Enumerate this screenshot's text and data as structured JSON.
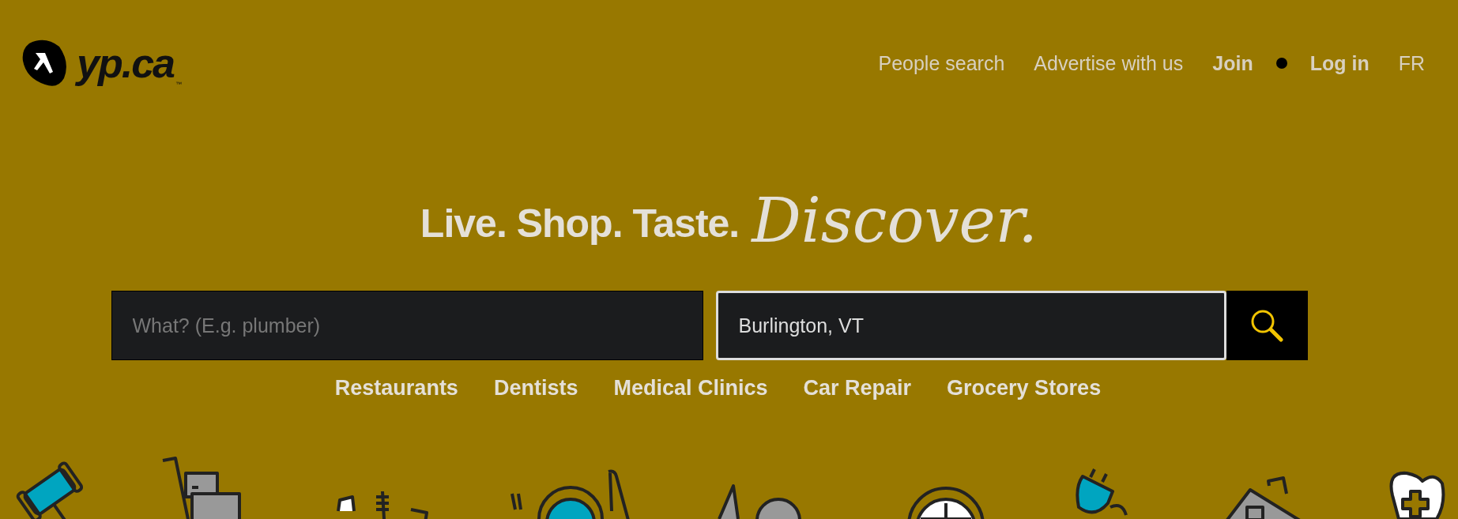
{
  "header": {
    "logo": "yp.ca",
    "logo_mark": "™",
    "nav": [
      {
        "label": "People search",
        "kind": "link"
      },
      {
        "label": "Advertise with us",
        "kind": "link"
      },
      {
        "label": "Join",
        "kind": "strong"
      },
      {
        "label": "Log in",
        "kind": "strong"
      },
      {
        "label": "FR",
        "kind": "link"
      }
    ]
  },
  "hero": {
    "tagline": "Live. Shop. Taste.",
    "script_word": "Discover."
  },
  "search": {
    "what": {
      "placeholder": "What? (E.g. plumber)"
    },
    "where": {
      "value": "Burlington, VT",
      "focused": true
    }
  },
  "categories": [
    "Restaurants",
    "Dentists",
    "Medical Clinics",
    "Car Repair",
    "Grocery Stores"
  ]
}
